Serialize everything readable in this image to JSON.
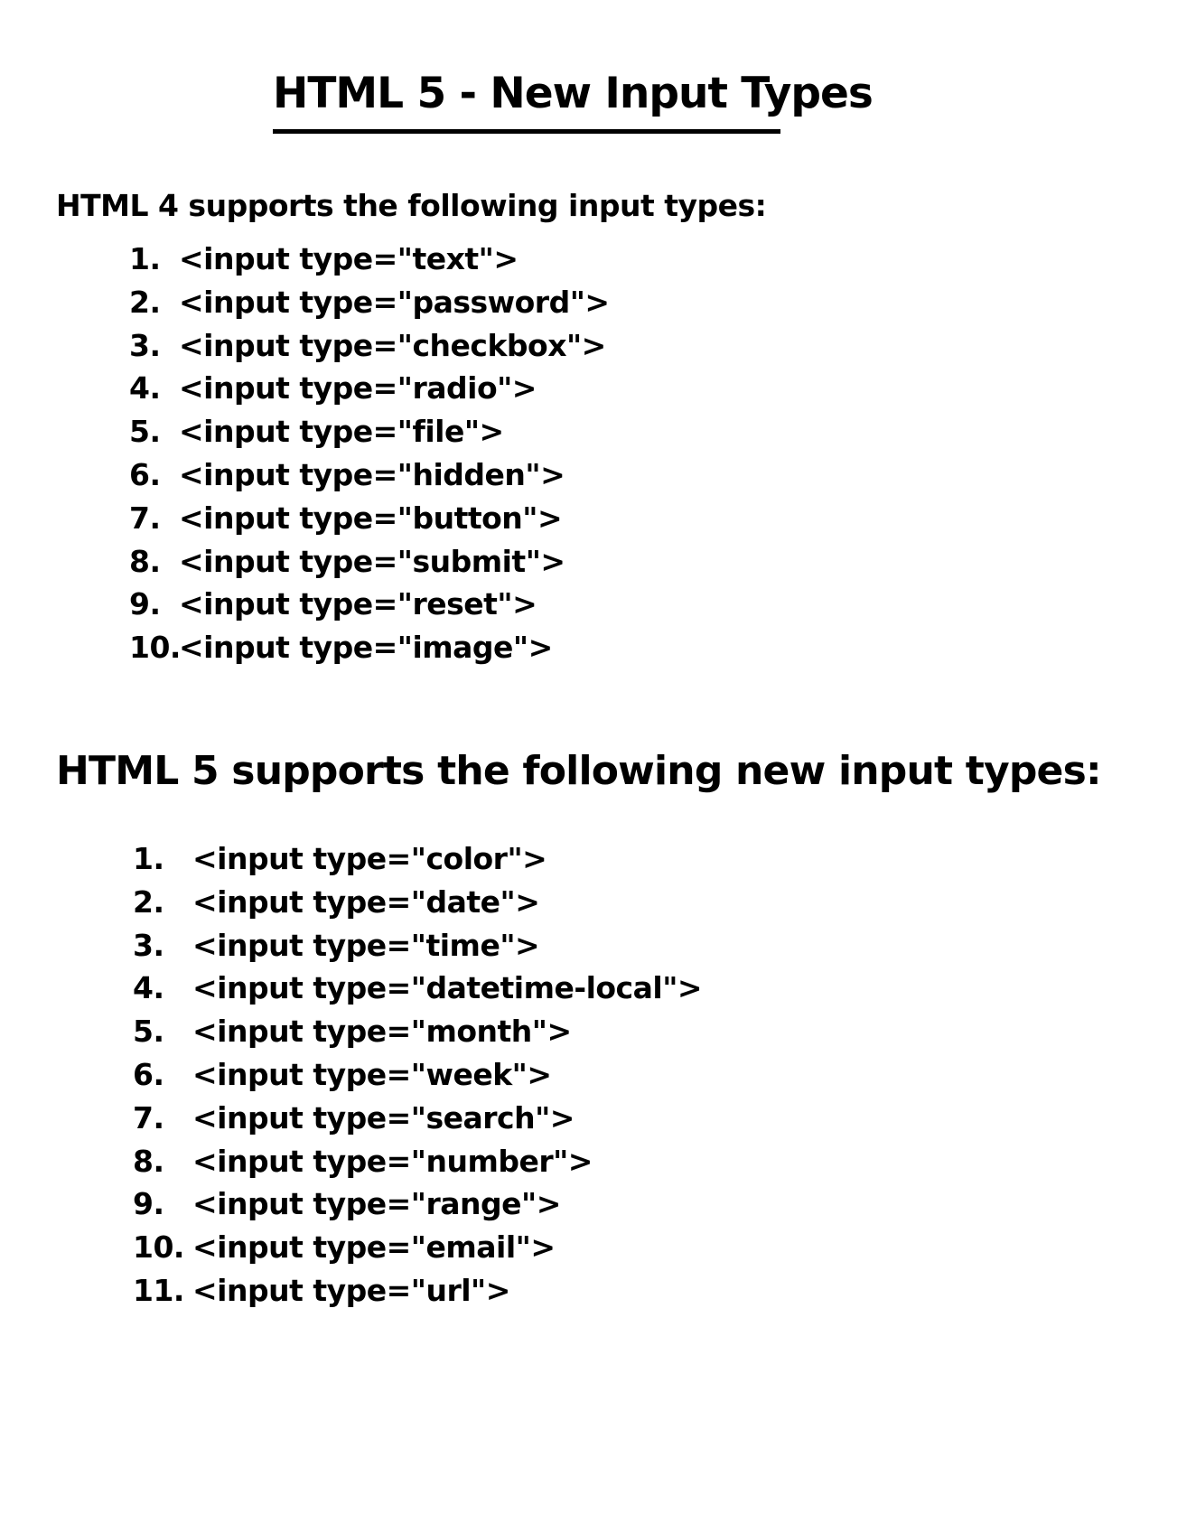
{
  "title": "HTML 5 - New Input Types",
  "html4": {
    "heading": "HTML 4 supports the following input types:",
    "items": [
      {
        "num": "1.",
        "text": "<input type=\"text\">"
      },
      {
        "num": "2.",
        "text": "<input type=\"password\">"
      },
      {
        "num": "3.",
        "text": "<input type=\"checkbox\">"
      },
      {
        "num": "4.",
        "text": "<input type=\"radio\">"
      },
      {
        "num": "5.",
        "text": "<input type=\"file\">"
      },
      {
        "num": "6.",
        "text": "<input type=\"hidden\">"
      },
      {
        "num": "7.",
        "text": "<input type=\"button\">"
      },
      {
        "num": "8.",
        "text": "<input type=\"submit\">"
      },
      {
        "num": "9.",
        "text": "<input type=\"reset\">"
      },
      {
        "num": "10.",
        "text": "<input type=\"image\">"
      }
    ]
  },
  "html5": {
    "heading": "HTML 5 supports the following new input types:",
    "items": [
      {
        "num": "1.",
        "text": "<input type=\"color\">"
      },
      {
        "num": "2.",
        "text": "<input type=\"date\">"
      },
      {
        "num": "3.",
        "text": "<input type=\"time\">"
      },
      {
        "num": "4.",
        "text": "<input type=\"datetime-local\">"
      },
      {
        "num": "5.",
        "text": "<input type=\"month\">"
      },
      {
        "num": "6.",
        "text": "<input type=\"week\">"
      },
      {
        "num": "7.",
        "text": "<input type=\"search\">"
      },
      {
        "num": "8.",
        "text": "<input type=\"number\">"
      },
      {
        "num": "9.",
        "text": "<input type=\"range\">"
      },
      {
        "num": "10.",
        "text": "<input type=\"email\">"
      },
      {
        "num": "11.",
        "text": "<input type=\"url\">"
      }
    ]
  }
}
